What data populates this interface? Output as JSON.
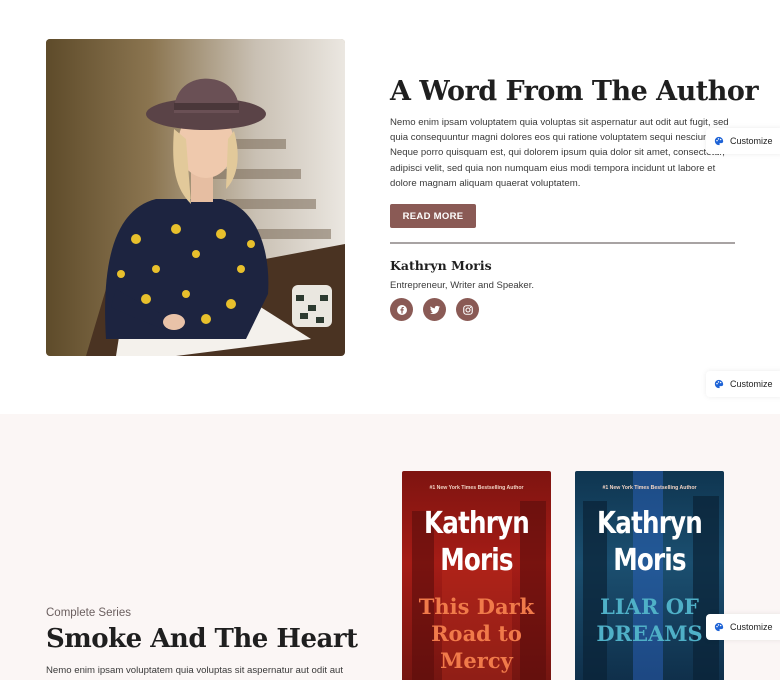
{
  "author": {
    "heading": "A Word From The Author",
    "body": "Nemo enim ipsam voluptatem quia voluptas sit aspernatur aut odit aut fugit, sed quia consequuntur magni dolores eos qui ratione voluptatem sequi nesciunt. Neque porro quisquam est, qui dolorem ipsum quia dolor sit amet, consectetur, adipisci velit, sed quia non numquam eius modi tempora incidunt ut labore et dolore magnam aliquam quaerat voluptatem.",
    "read_more_label": "READ MORE",
    "name": "Kathryn Moris",
    "role": "Entrepreneur, Writer and Speaker.",
    "socials": [
      {
        "icon": "facebook-icon"
      },
      {
        "icon": "twitter-icon"
      },
      {
        "icon": "instagram-icon"
      }
    ]
  },
  "customize": {
    "label": "Customize"
  },
  "series": {
    "kicker": "Complete Series",
    "title": "Smoke And The Heart",
    "body": "Nemo enim ipsam voluptatem quia voluptas sit aspernatur aut odit aut",
    "books": [
      {
        "tagline": "#1 New York Times Bestselling Author",
        "author_line1": "Kathryn",
        "author_line2": "Moris",
        "title_line1": "This Dark",
        "title_line2": "Road to",
        "title_line3": "Mercy"
      },
      {
        "tagline": "#1 New York Times Bestselling Author",
        "author_line1": "Kathryn",
        "author_line2": "Moris",
        "title_line1": "LIAR OF",
        "title_line2": "DREAMS"
      }
    ]
  },
  "colors": {
    "accent": "#8a5a55",
    "series_bg": "#fbf6f5",
    "customize_icon": "#1e63d6"
  }
}
